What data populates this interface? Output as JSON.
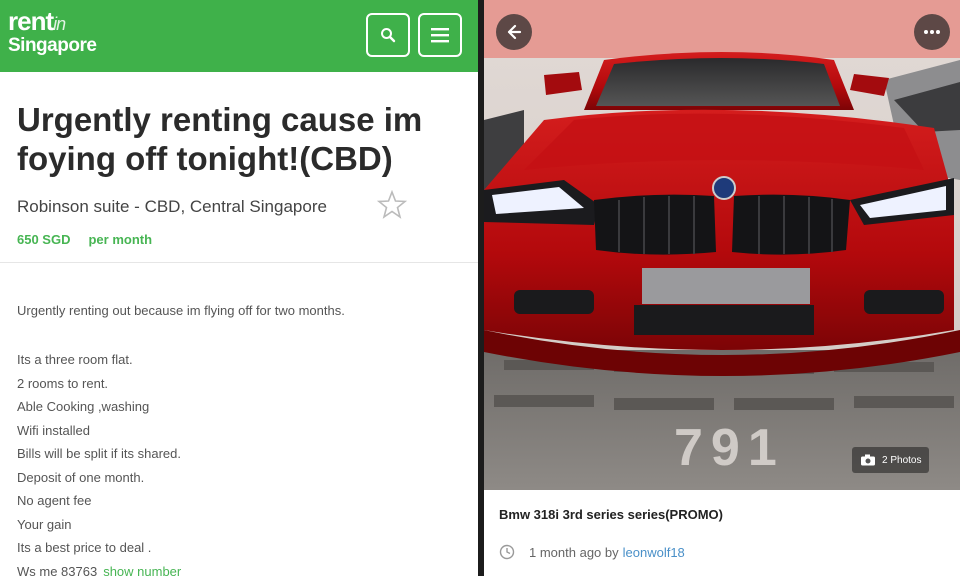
{
  "left": {
    "header": {
      "logo_line1": "rent",
      "logo_line1_small": "in",
      "logo_line2": "Singapore",
      "search_icon": "search-icon",
      "menu_icon": "hamburger-menu-icon",
      "color": "#3fb14a"
    },
    "listing": {
      "title": "Urgently renting cause im foying off tonight!(CBD)",
      "location": "Robinson suite - CBD, Central Singapore",
      "price": "650 SGD",
      "period": "per month",
      "intro": "Urgently renting out because im flying off for two months.",
      "details": [
        "Its a three room flat.",
        "2 rooms to rent.",
        "Able Cooking ,washing",
        "Wifi installed",
        "Bills will be split if its shared.",
        "Deposit of one month.",
        "No agent fee",
        "Your gain",
        "Its a best price to deal ."
      ],
      "contact": "Ws me 83763",
      "show_number": "show number"
    }
  },
  "right": {
    "photo_overlay_text": "791",
    "photos_count": "2 Photos",
    "car_title": "Bmw 318i 3rd series series(PROMO)",
    "posted": "1 month ago by",
    "username": "leonwolf18",
    "accent_link": "#4a90c8"
  }
}
